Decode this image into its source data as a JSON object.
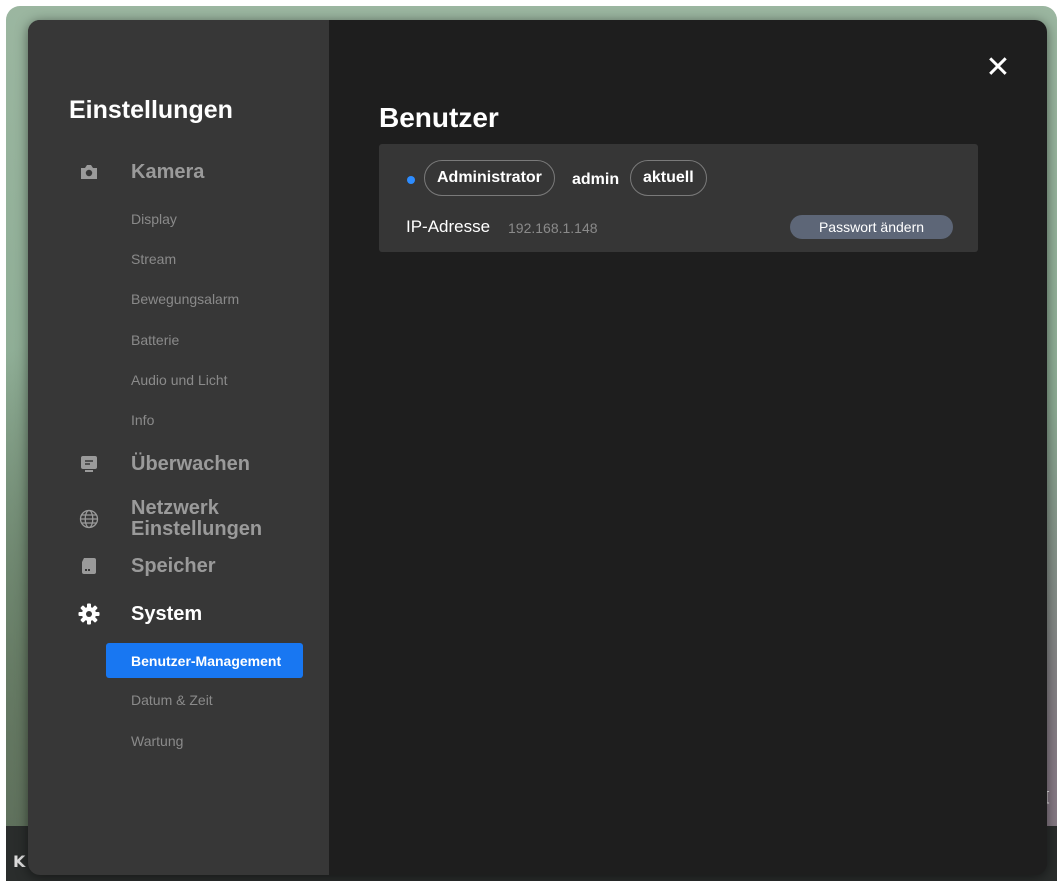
{
  "sidebar": {
    "title": "Einstellungen",
    "sections": [
      {
        "label": "Kamera",
        "icon": "camera-icon",
        "items": [
          "Display",
          "Stream",
          "Bewegungsalarm",
          "Batterie",
          "Audio und Licht",
          "Info"
        ]
      },
      {
        "label": "Überwachen",
        "icon": "monitor-icon"
      },
      {
        "label_line1": "Netzwerk",
        "label_line2": "Einstellungen",
        "icon": "globe-icon"
      },
      {
        "label": "Speicher",
        "icon": "sd-card-icon"
      },
      {
        "label": "System",
        "icon": "gear-icon",
        "items": [
          "Benutzer-Management",
          "Datum & Zeit",
          "Wartung"
        ],
        "active_item": "Benutzer-Management"
      }
    ]
  },
  "main": {
    "title": "Benutzer",
    "close_symbol": "✕",
    "user": {
      "role": "Administrator",
      "name": "admin",
      "status": "aktuell",
      "ip_label": "IP-Adresse",
      "ip_value": "192.168.1.148",
      "change_password_label": "Passwort ändern"
    }
  },
  "colors": {
    "accent": "#1877f2",
    "sidebar_bg": "#373737",
    "main_bg": "#1e1e1e",
    "card_bg": "#363636",
    "button_bg": "#5d6677",
    "status_dot": "#2d8cff"
  }
}
